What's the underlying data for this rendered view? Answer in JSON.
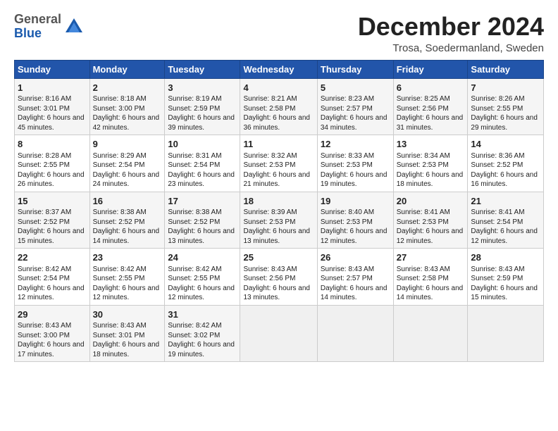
{
  "logo": {
    "general": "General",
    "blue": "Blue"
  },
  "title": "December 2024",
  "subtitle": "Trosa, Soedermanland, Sweden",
  "days_header": [
    "Sunday",
    "Monday",
    "Tuesday",
    "Wednesday",
    "Thursday",
    "Friday",
    "Saturday"
  ],
  "weeks": [
    [
      {
        "day": "1",
        "sunrise": "Sunrise: 8:16 AM",
        "sunset": "Sunset: 3:01 PM",
        "daylight": "Daylight: 6 hours and 45 minutes."
      },
      {
        "day": "2",
        "sunrise": "Sunrise: 8:18 AM",
        "sunset": "Sunset: 3:00 PM",
        "daylight": "Daylight: 6 hours and 42 minutes."
      },
      {
        "day": "3",
        "sunrise": "Sunrise: 8:19 AM",
        "sunset": "Sunset: 2:59 PM",
        "daylight": "Daylight: 6 hours and 39 minutes."
      },
      {
        "day": "4",
        "sunrise": "Sunrise: 8:21 AM",
        "sunset": "Sunset: 2:58 PM",
        "daylight": "Daylight: 6 hours and 36 minutes."
      },
      {
        "day": "5",
        "sunrise": "Sunrise: 8:23 AM",
        "sunset": "Sunset: 2:57 PM",
        "daylight": "Daylight: 6 hours and 34 minutes."
      },
      {
        "day": "6",
        "sunrise": "Sunrise: 8:25 AM",
        "sunset": "Sunset: 2:56 PM",
        "daylight": "Daylight: 6 hours and 31 minutes."
      },
      {
        "day": "7",
        "sunrise": "Sunrise: 8:26 AM",
        "sunset": "Sunset: 2:55 PM",
        "daylight": "Daylight: 6 hours and 29 minutes."
      }
    ],
    [
      {
        "day": "8",
        "sunrise": "Sunrise: 8:28 AM",
        "sunset": "Sunset: 2:55 PM",
        "daylight": "Daylight: 6 hours and 26 minutes."
      },
      {
        "day": "9",
        "sunrise": "Sunrise: 8:29 AM",
        "sunset": "Sunset: 2:54 PM",
        "daylight": "Daylight: 6 hours and 24 minutes."
      },
      {
        "day": "10",
        "sunrise": "Sunrise: 8:31 AM",
        "sunset": "Sunset: 2:54 PM",
        "daylight": "Daylight: 6 hours and 23 minutes."
      },
      {
        "day": "11",
        "sunrise": "Sunrise: 8:32 AM",
        "sunset": "Sunset: 2:53 PM",
        "daylight": "Daylight: 6 hours and 21 minutes."
      },
      {
        "day": "12",
        "sunrise": "Sunrise: 8:33 AM",
        "sunset": "Sunset: 2:53 PM",
        "daylight": "Daylight: 6 hours and 19 minutes."
      },
      {
        "day": "13",
        "sunrise": "Sunrise: 8:34 AM",
        "sunset": "Sunset: 2:53 PM",
        "daylight": "Daylight: 6 hours and 18 minutes."
      },
      {
        "day": "14",
        "sunrise": "Sunrise: 8:36 AM",
        "sunset": "Sunset: 2:52 PM",
        "daylight": "Daylight: 6 hours and 16 minutes."
      }
    ],
    [
      {
        "day": "15",
        "sunrise": "Sunrise: 8:37 AM",
        "sunset": "Sunset: 2:52 PM",
        "daylight": "Daylight: 6 hours and 15 minutes."
      },
      {
        "day": "16",
        "sunrise": "Sunrise: 8:38 AM",
        "sunset": "Sunset: 2:52 PM",
        "daylight": "Daylight: 6 hours and 14 minutes."
      },
      {
        "day": "17",
        "sunrise": "Sunrise: 8:38 AM",
        "sunset": "Sunset: 2:52 PM",
        "daylight": "Daylight: 6 hours and 13 minutes."
      },
      {
        "day": "18",
        "sunrise": "Sunrise: 8:39 AM",
        "sunset": "Sunset: 2:53 PM",
        "daylight": "Daylight: 6 hours and 13 minutes."
      },
      {
        "day": "19",
        "sunrise": "Sunrise: 8:40 AM",
        "sunset": "Sunset: 2:53 PM",
        "daylight": "Daylight: 6 hours and 12 minutes."
      },
      {
        "day": "20",
        "sunrise": "Sunrise: 8:41 AM",
        "sunset": "Sunset: 2:53 PM",
        "daylight": "Daylight: 6 hours and 12 minutes."
      },
      {
        "day": "21",
        "sunrise": "Sunrise: 8:41 AM",
        "sunset": "Sunset: 2:54 PM",
        "daylight": "Daylight: 6 hours and 12 minutes."
      }
    ],
    [
      {
        "day": "22",
        "sunrise": "Sunrise: 8:42 AM",
        "sunset": "Sunset: 2:54 PM",
        "daylight": "Daylight: 6 hours and 12 minutes."
      },
      {
        "day": "23",
        "sunrise": "Sunrise: 8:42 AM",
        "sunset": "Sunset: 2:55 PM",
        "daylight": "Daylight: 6 hours and 12 minutes."
      },
      {
        "day": "24",
        "sunrise": "Sunrise: 8:42 AM",
        "sunset": "Sunset: 2:55 PM",
        "daylight": "Daylight: 6 hours and 12 minutes."
      },
      {
        "day": "25",
        "sunrise": "Sunrise: 8:43 AM",
        "sunset": "Sunset: 2:56 PM",
        "daylight": "Daylight: 6 hours and 13 minutes."
      },
      {
        "day": "26",
        "sunrise": "Sunrise: 8:43 AM",
        "sunset": "Sunset: 2:57 PM",
        "daylight": "Daylight: 6 hours and 14 minutes."
      },
      {
        "day": "27",
        "sunrise": "Sunrise: 8:43 AM",
        "sunset": "Sunset: 2:58 PM",
        "daylight": "Daylight: 6 hours and 14 minutes."
      },
      {
        "day": "28",
        "sunrise": "Sunrise: 8:43 AM",
        "sunset": "Sunset: 2:59 PM",
        "daylight": "Daylight: 6 hours and 15 minutes."
      }
    ],
    [
      {
        "day": "29",
        "sunrise": "Sunrise: 8:43 AM",
        "sunset": "Sunset: 3:00 PM",
        "daylight": "Daylight: 6 hours and 17 minutes."
      },
      {
        "day": "30",
        "sunrise": "Sunrise: 8:43 AM",
        "sunset": "Sunset: 3:01 PM",
        "daylight": "Daylight: 6 hours and 18 minutes."
      },
      {
        "day": "31",
        "sunrise": "Sunrise: 8:42 AM",
        "sunset": "Sunset: 3:02 PM",
        "daylight": "Daylight: 6 hours and 19 minutes."
      },
      null,
      null,
      null,
      null
    ]
  ]
}
